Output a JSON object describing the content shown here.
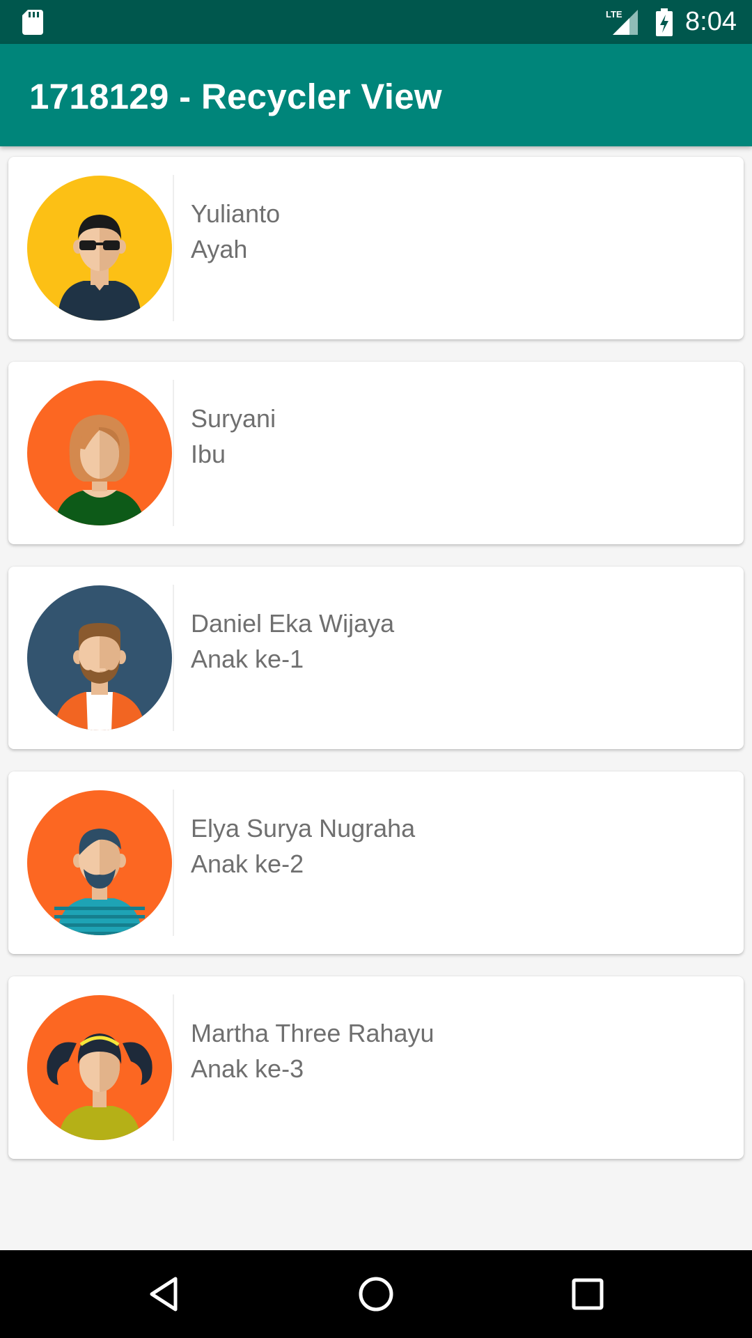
{
  "status_bar": {
    "time": "8:04",
    "network_label": "LTE",
    "icons": [
      "sd-card-icon",
      "lte-signal-icon",
      "battery-charging-icon"
    ]
  },
  "app_bar": {
    "title": "1718129 - Recycler View",
    "color": "#00857a"
  },
  "family": [
    {
      "name": "Yulianto",
      "role": "Ayah",
      "avatar": "man-sunglasses-avatar",
      "bg": "#fcc015"
    },
    {
      "name": "Suryani",
      "role": "Ibu",
      "avatar": "woman-avatar",
      "bg": "#fc6722"
    },
    {
      "name": "Daniel Eka Wijaya",
      "role": "Anak ke-1",
      "avatar": "bearded-man-avatar",
      "bg": "#33546f"
    },
    {
      "name": "Elya Surya Nugraha",
      "role": "Anak ke-2",
      "avatar": "man-striped-shirt-avatar",
      "bg": "#fc6722"
    },
    {
      "name": "Martha Three Rahayu",
      "role": "Anak ke-3",
      "avatar": "girl-pigtails-avatar",
      "bg": "#fc6722"
    }
  ],
  "nav_bar": {
    "icons": [
      "back-icon",
      "home-icon",
      "recents-icon"
    ]
  }
}
